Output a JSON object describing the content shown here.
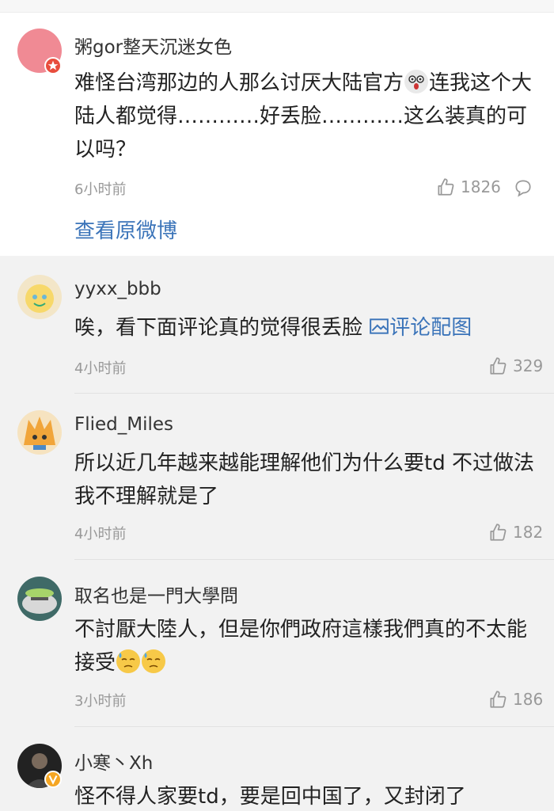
{
  "main_post": {
    "username": "粥gor整天沉迷女色",
    "text_1": "难怪台湾那边的人那么讨厌大陆官方",
    "text_2": "连我这个大陆人都觉得…………好丢脸…………这么装真的可以吗？",
    "time": "6小时前",
    "likes": "1826",
    "view_original": "查看原微博"
  },
  "replies": [
    {
      "username": "yyxx_bbb",
      "text": "唉，看下面评论真的觉得很丢脸",
      "image_link": "评论配图",
      "time": "4小时前",
      "likes": "329"
    },
    {
      "username": "Flied_Miles",
      "text": "所以近几年越来越能理解他们为什么要td 不过做法我不理解就是了",
      "time": "4小时前",
      "likes": "182"
    },
    {
      "username": "取名也是一門大學問",
      "text": "不討厭大陸人，但是你們政府這樣我們真的不太能接受",
      "time": "3小时前",
      "likes": "186"
    },
    {
      "username": "小寒丶Xh",
      "text": "怪不得人家要td，要是回中国了，又封闭了"
    }
  ],
  "icons": {
    "like": "thumbs-up-icon",
    "comment": "comment-bubble-icon",
    "image": "image-icon",
    "emoji": "sweat-emoji-icon",
    "badge": "verified-badge-icon"
  },
  "colors": {
    "link": "#3b74b9",
    "text_muted": "#999999",
    "vip_orange": "#f5a623",
    "badge_red": "#e84d3d"
  }
}
